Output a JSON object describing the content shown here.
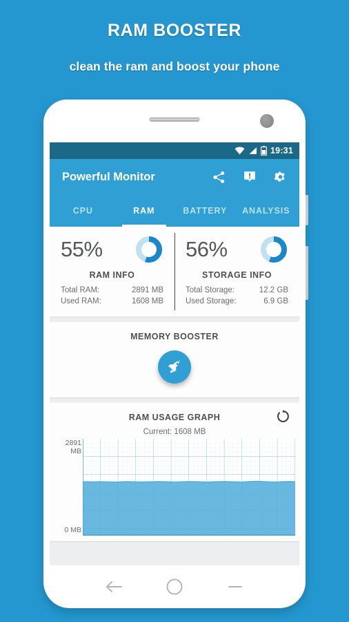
{
  "promo": {
    "title": "RAM BOOSTER",
    "subtitle": "clean the ram and boost your phone",
    "background_color": "#2497d0"
  },
  "statusbar": {
    "time": "19:31",
    "icons": [
      "wifi-icon",
      "signal-icon",
      "battery-icon"
    ],
    "background_color": "#1b6888"
  },
  "appbar": {
    "title": "Powerful Monitor",
    "background_color": "#2f9fd4",
    "actions": [
      {
        "name": "share-icon",
        "label": "Share"
      },
      {
        "name": "feedback-icon",
        "label": "Feedback"
      },
      {
        "name": "settings-gear-icon",
        "label": "Settings"
      }
    ]
  },
  "tabs": [
    {
      "label": "CPU",
      "active": false
    },
    {
      "label": "RAM",
      "active": true
    },
    {
      "label": "BATTERY",
      "active": false
    },
    {
      "label": "ANALYSIS",
      "active": false
    }
  ],
  "ram_info": {
    "percent": "55%",
    "percent_value": 55,
    "title": "RAM INFO",
    "rows": [
      {
        "label": "Total RAM:",
        "value": "2891 MB"
      },
      {
        "label": "Used RAM:",
        "value": "1608 MB"
      }
    ]
  },
  "storage_info": {
    "percent": "56%",
    "percent_value": 56,
    "title": "STORAGE INFO",
    "rows": [
      {
        "label": "Total Storage:",
        "value": "12.2 GB"
      },
      {
        "label": "Used Storage:",
        "value": "6.9 GB"
      }
    ]
  },
  "memory_booster": {
    "title": "MEMORY BOOSTER",
    "button_icon": "rocket-icon",
    "button_color": "#2f9fd4"
  },
  "graph_card": {
    "title": "RAM USAGE GRAPH",
    "refresh_icon": "refresh-icon",
    "current_label": "Current: 1608 MB"
  },
  "chart_data": {
    "type": "area",
    "title": "RAM USAGE GRAPH",
    "subtitle": "Current: 1608 MB",
    "xlabel": "",
    "ylabel": "MB",
    "ylim": [
      0,
      2891
    ],
    "ytick_labels": [
      "2891\nMB",
      "0 MB"
    ],
    "yticks": [
      2891,
      0
    ],
    "grid": true,
    "legend": "none",
    "series": [
      {
        "name": "Used RAM (MB)",
        "color": "#5cb3dd",
        "values": [
          1608,
          1610,
          1606,
          1612,
          1608,
          1604,
          1600,
          1609,
          1614,
          1611,
          1607,
          1603,
          1608,
          1612,
          1616,
          1610,
          1605,
          1602,
          1608,
          1613,
          1617,
          1611,
          1606,
          1601,
          1608,
          1615,
          1620,
          1612,
          1605,
          1600,
          1608,
          1618,
          1624,
          1616,
          1608,
          1602,
          1607,
          1613,
          1619,
          1612
        ]
      }
    ]
  },
  "navbar": {
    "buttons": [
      {
        "name": "nav-back-icon",
        "label": "Back"
      },
      {
        "name": "nav-home-icon",
        "label": "Home"
      },
      {
        "name": "nav-recents-icon",
        "label": "Recents"
      }
    ]
  }
}
